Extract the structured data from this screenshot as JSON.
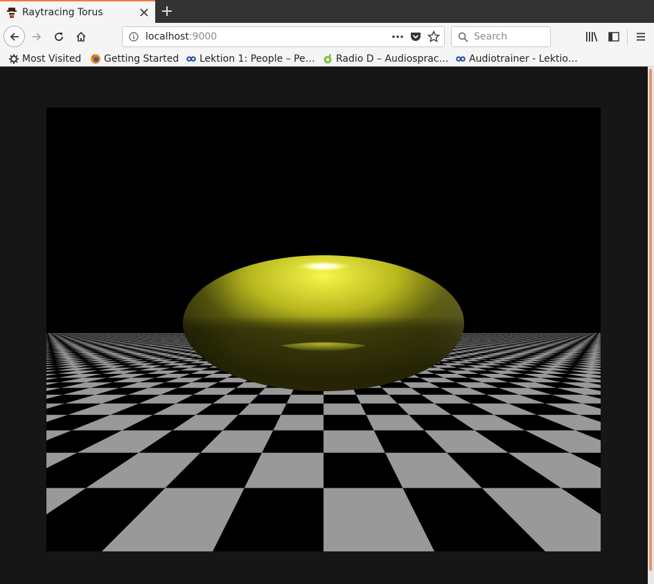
{
  "browser": {
    "tab": {
      "title": "Raytracing Torus"
    },
    "url": {
      "host": "localhost",
      "port": ":9000"
    },
    "search": {
      "placeholder": "Search"
    },
    "bookmarks": [
      {
        "label": "Most Visited",
        "icon": "gear-icon"
      },
      {
        "label": "Getting Started",
        "icon": "firefox-icon"
      },
      {
        "label": "Lektion 1: People – Pe…",
        "icon": "dw-icon"
      },
      {
        "label": "Radio D – Audiosprac…",
        "icon": "radio-d-icon"
      },
      {
        "label": "Audiotrainer - Lektio…",
        "icon": "dw-icon"
      }
    ]
  },
  "scene": {
    "object": "torus",
    "torus_color": "#d8d820",
    "floor_colors": [
      "#000000",
      "#999999"
    ],
    "background": "#000000"
  }
}
